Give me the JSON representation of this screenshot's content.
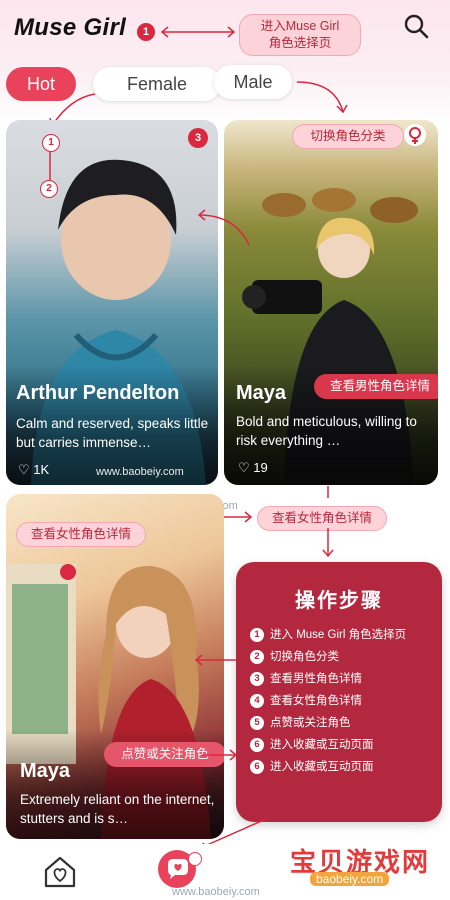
{
  "header": {
    "brand": "Muse Girl"
  },
  "tabs": {
    "hot": "Hot",
    "female": "Female",
    "male": "Male"
  },
  "callouts": {
    "enter_selection": "进入Muse Girl\n角色选择页",
    "switch_category": "切换角色分类",
    "male_detail": "查看男性角色详情",
    "female_detail_left": "查看女性角色详情",
    "female_detail_mid": "查看女性角色详情",
    "like_follow": "点赞或关注角色"
  },
  "markers": [
    "1",
    "1",
    "2",
    "3"
  ],
  "cards": [
    {
      "name": "Arthur Pendelton",
      "desc": "Calm and reserved, speaks little but carries immense…",
      "likes": "1K",
      "watermark": "www.baobeiy.com"
    },
    {
      "name": "Maya",
      "desc": "Bold and meticulous, willing to risk everything …",
      "likes": "19"
    },
    {
      "name": "Maya",
      "desc": "Extremely reliant on the internet, stutters and is s…"
    }
  ],
  "mid_watermark": "www.baobeiy.com",
  "steps_panel": {
    "title": "操作步骤",
    "steps": [
      {
        "n": "1",
        "text": "进入 Muse Girl 角色选择页"
      },
      {
        "n": "2",
        "text": "切换角色分类"
      },
      {
        "n": "3",
        "text": "查看男性角色详情"
      },
      {
        "n": "4",
        "text": "查看女性角色详情"
      },
      {
        "n": "5",
        "text": "点赞或关注角色"
      },
      {
        "n": "6",
        "text": "进入收藏或互动页面"
      },
      {
        "n": "6",
        "text": "进入收藏或互动页面"
      }
    ]
  },
  "bottom": {
    "watermark": "www.baobeiy.com",
    "site_logo": "宝贝游戏网",
    "site_domain": "baobeiy.com"
  },
  "colors": {
    "accent": "#e8435a",
    "panel": "#b3283f",
    "callout_bg": "#fbd3d8"
  }
}
